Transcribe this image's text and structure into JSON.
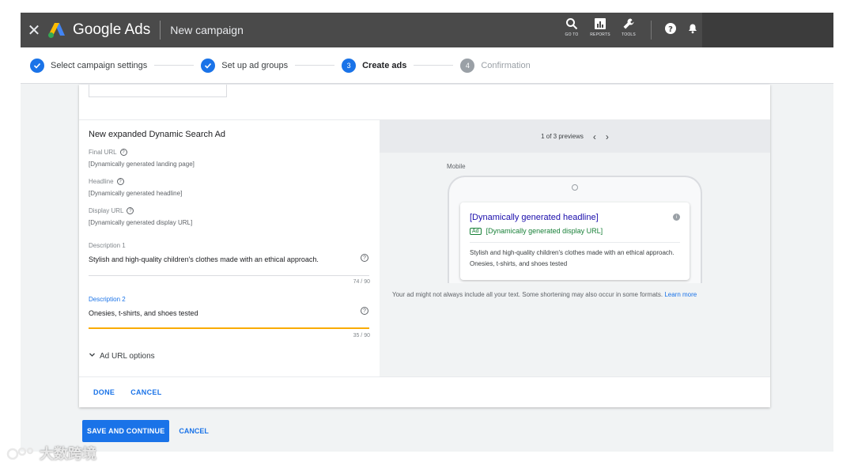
{
  "topbar": {
    "brand": "Google Ads",
    "page_title": "New campaign",
    "tools": [
      {
        "label": "GO TO",
        "icon": "search-icon"
      },
      {
        "label": "REPORTS",
        "icon": "reports-icon"
      },
      {
        "label": "TOOLS",
        "icon": "wrench-icon"
      }
    ],
    "help_icon": "help-icon",
    "notifications_icon": "bell-icon"
  },
  "stepper": {
    "steps": [
      {
        "number": "1",
        "label": "Select campaign settings",
        "state": "done"
      },
      {
        "number": "2",
        "label": "Set up ad groups",
        "state": "done"
      },
      {
        "number": "3",
        "label": "Create ads",
        "state": "active"
      },
      {
        "number": "4",
        "label": "Confirmation",
        "state": "todo"
      }
    ]
  },
  "editor": {
    "title": "New expanded Dynamic Search Ad",
    "final_url_label": "Final URL",
    "final_url_value": "[Dynamically generated landing page]",
    "headline_label": "Headline",
    "headline_value": "[Dynamically generated headline]",
    "display_url_label": "Display URL",
    "display_url_value": "[Dynamically generated display URL]",
    "description1_label": "Description 1",
    "description1_value": "Stylish and high-quality children's clothes made with an ethical approach.",
    "description1_counter": "74 / 90",
    "description2_label": "Description 2",
    "description2_value": "Onesies, t-shirts, and shoes tested",
    "description2_counter": "35 / 90",
    "url_options_label": "Ad URL options",
    "help_glyph": "?"
  },
  "preview": {
    "pager": "1 of 3 previews",
    "device_label": "Mobile",
    "ad_headline": "[Dynamically generated headline]",
    "ad_badge": "Ad",
    "ad_display_url": "[Dynamically generated display URL]",
    "ad_description": "Stylish and high-quality children's clothes made with an ethical approach. Onesies, t-shirts, and shoes tested",
    "info_glyph": "i",
    "note": "Your ad might not always include all your text. Some shortening may also occur in some formats.",
    "learn_more": "Learn more"
  },
  "card_footer": {
    "done_label": "DONE",
    "cancel_label": "CANCEL"
  },
  "page_footer": {
    "save_label": "SAVE AND CONTINUE",
    "cancel_label": "CANCEL"
  },
  "watermark": {
    "text": "大数跨境"
  },
  "colors": {
    "topbar_bg": "#4a4a4a",
    "accent_blue": "#1a73e8",
    "focus_yellow": "#f9ab00",
    "ad_headline": "#1a0dab",
    "ad_url_green": "#188038"
  }
}
